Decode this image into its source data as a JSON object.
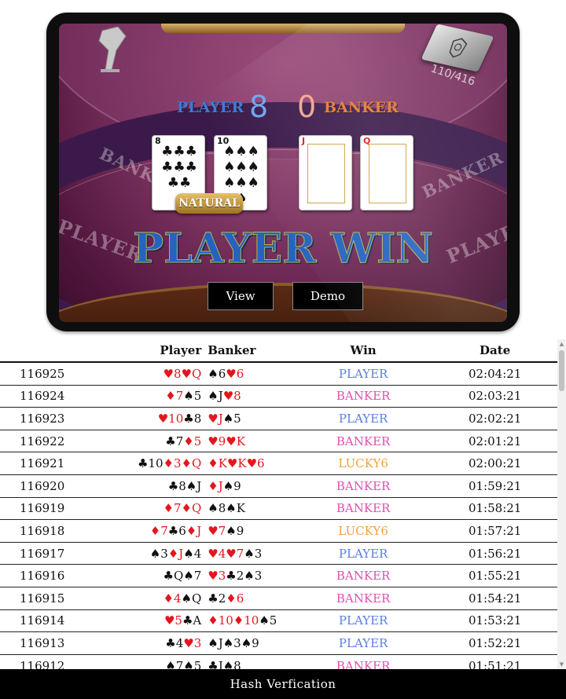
{
  "game": {
    "shoe_count": "110/416",
    "player_label": "PLAYER",
    "banker_label": "BANKER",
    "player_score": "8",
    "banker_score": "0",
    "badge": "NATURAL",
    "result": "PLAYER WIN",
    "felt_banker": "BANKER",
    "felt_player": "PLAYER",
    "cards": [
      {
        "rank": "8",
        "suit": "♣",
        "color": "#111111"
      },
      {
        "rank": "10",
        "suit": "♠",
        "color": "#111111"
      },
      {
        "rank": "J",
        "suit": "♥",
        "color": "#e3161e"
      },
      {
        "rank": "Q",
        "suit": "♥",
        "color": "#e3161e"
      }
    ]
  },
  "buttons": {
    "view": "View",
    "demo": "Demo"
  },
  "table": {
    "headers": {
      "player": "Player",
      "banker": "Banker",
      "win": "Win",
      "date": "Date"
    },
    "rows": [
      {
        "id": "116925",
        "player": [
          [
            "♥8",
            "r"
          ],
          [
            "♥Q",
            "r"
          ]
        ],
        "banker": [
          [
            "♠6",
            "b"
          ],
          [
            "♥6",
            "r"
          ]
        ],
        "win": "PLAYER",
        "date": "02:04:21"
      },
      {
        "id": "116924",
        "player": [
          [
            "♦7",
            "r"
          ],
          [
            "♠5",
            "b"
          ]
        ],
        "banker": [
          [
            "♠J",
            "b"
          ],
          [
            "♥8",
            "r"
          ]
        ],
        "win": "BANKER",
        "date": "02:03:21"
      },
      {
        "id": "116923",
        "player": [
          [
            "♥10",
            "r"
          ],
          [
            "♣8",
            "b"
          ]
        ],
        "banker": [
          [
            "♥J",
            "r"
          ],
          [
            "♠5",
            "b"
          ]
        ],
        "win": "PLAYER",
        "date": "02:02:21"
      },
      {
        "id": "116922",
        "player": [
          [
            "♣7",
            "b"
          ],
          [
            "♦5",
            "r"
          ]
        ],
        "banker": [
          [
            "♥9",
            "r"
          ],
          [
            "♥K",
            "r"
          ]
        ],
        "win": "BANKER",
        "date": "02:01:21"
      },
      {
        "id": "116921",
        "player": [
          [
            "♣10",
            "b"
          ],
          [
            "♦3",
            "r"
          ],
          [
            "♦Q",
            "r"
          ]
        ],
        "banker": [
          [
            "♦K",
            "r"
          ],
          [
            "♥K",
            "r"
          ],
          [
            "♥6",
            "r"
          ]
        ],
        "win": "LUCKY6",
        "date": "02:00:21"
      },
      {
        "id": "116920",
        "player": [
          [
            "♣8",
            "b"
          ],
          [
            "♠J",
            "b"
          ]
        ],
        "banker": [
          [
            "♦J",
            "r"
          ],
          [
            "♠9",
            "b"
          ]
        ],
        "win": "BANKER",
        "date": "01:59:21"
      },
      {
        "id": "116919",
        "player": [
          [
            "♦7",
            "r"
          ],
          [
            "♦Q",
            "r"
          ]
        ],
        "banker": [
          [
            "♠8",
            "b"
          ],
          [
            "♠K",
            "b"
          ]
        ],
        "win": "BANKER",
        "date": "01:58:21"
      },
      {
        "id": "116918",
        "player": [
          [
            "♦7",
            "r"
          ],
          [
            "♣6",
            "b"
          ],
          [
            "♦J",
            "r"
          ]
        ],
        "banker": [
          [
            "♥7",
            "r"
          ],
          [
            "♠9",
            "b"
          ]
        ],
        "win": "LUCKY6",
        "date": "01:57:21"
      },
      {
        "id": "116917",
        "player": [
          [
            "♠3",
            "b"
          ],
          [
            "♦J",
            "r"
          ],
          [
            "♠4",
            "b"
          ]
        ],
        "banker": [
          [
            "♥4",
            "r"
          ],
          [
            "♥7",
            "r"
          ],
          [
            "♠3",
            "b"
          ]
        ],
        "win": "PLAYER",
        "date": "01:56:21"
      },
      {
        "id": "116916",
        "player": [
          [
            "♣Q",
            "b"
          ],
          [
            "♠7",
            "b"
          ]
        ],
        "banker": [
          [
            "♥3",
            "r"
          ],
          [
            "♣2",
            "b"
          ],
          [
            "♠3",
            "b"
          ]
        ],
        "win": "BANKER",
        "date": "01:55:21"
      },
      {
        "id": "116915",
        "player": [
          [
            "♦4",
            "r"
          ],
          [
            "♠Q",
            "b"
          ]
        ],
        "banker": [
          [
            "♣2",
            "b"
          ],
          [
            "♦6",
            "r"
          ]
        ],
        "win": "BANKER",
        "date": "01:54:21"
      },
      {
        "id": "116914",
        "player": [
          [
            "♥5",
            "r"
          ],
          [
            "♣A",
            "b"
          ]
        ],
        "banker": [
          [
            "♦10",
            "r"
          ],
          [
            "♦10",
            "r"
          ],
          [
            "♠5",
            "b"
          ]
        ],
        "win": "PLAYER",
        "date": "01:53:21"
      },
      {
        "id": "116913",
        "player": [
          [
            "♣4",
            "b"
          ],
          [
            "♥3",
            "r"
          ]
        ],
        "banker": [
          [
            "♠J",
            "b"
          ],
          [
            "♠3",
            "b"
          ],
          [
            "♠9",
            "b"
          ]
        ],
        "win": "PLAYER",
        "date": "01:52:21"
      },
      {
        "id": "116912",
        "player": [
          [
            "♠7",
            "b"
          ],
          [
            "♠5",
            "b"
          ]
        ],
        "banker": [
          [
            "♣J",
            "b"
          ],
          [
            "♠8",
            "b"
          ]
        ],
        "win": "BANKER",
        "date": "01:51:21"
      }
    ],
    "win_colors": {
      "PLAYER": "#5b7ee5",
      "BANKER": "#e24fb2",
      "LUCKY6": "#f0a23a"
    }
  },
  "footer": {
    "label": "Hash Verfication"
  }
}
